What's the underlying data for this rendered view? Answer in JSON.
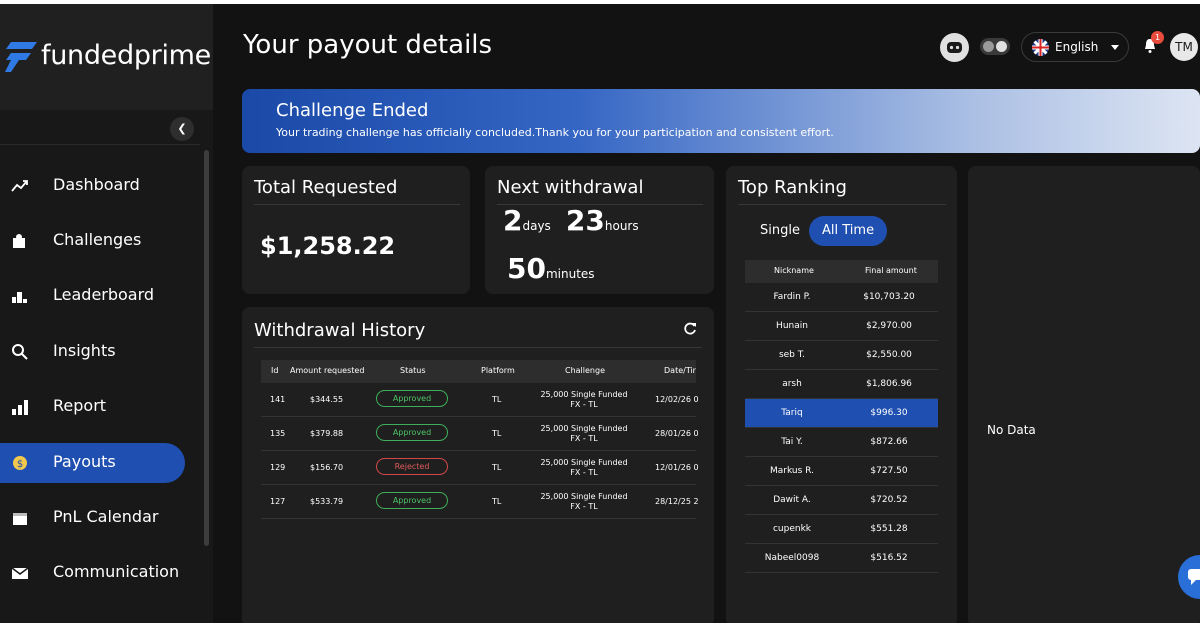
{
  "brand": {
    "name": "fundedprime"
  },
  "sidebar": {
    "items": [
      {
        "label": "Dashboard",
        "icon": "trend-icon"
      },
      {
        "label": "Challenges",
        "icon": "puzzle-icon"
      },
      {
        "label": "Leaderboard",
        "icon": "podium-icon"
      },
      {
        "label": "Insights",
        "icon": "search-icon"
      },
      {
        "label": "Report",
        "icon": "bar-chart-icon"
      },
      {
        "label": "Payouts",
        "icon": "dollar-icon",
        "active": true
      },
      {
        "label": "PnL Calendar",
        "icon": "calendar-icon"
      },
      {
        "label": "Communication",
        "icon": "mail-icon"
      }
    ]
  },
  "header": {
    "title": "Your payout details",
    "language": "English",
    "notification_count": "1",
    "avatar_initials": "TM"
  },
  "banner": {
    "title": "Challenge Ended",
    "subtitle": "Your trading challenge has officially concluded.Thank you for your participation and consistent effort."
  },
  "total_requested": {
    "title": "Total Requested",
    "amount": "$1,258.22"
  },
  "next_withdrawal": {
    "title": "Next withdrawal",
    "days": "2",
    "days_unit": "days",
    "hours": "23",
    "hours_unit": "hours",
    "minutes": "50",
    "minutes_unit": "minutes"
  },
  "withdrawal_history": {
    "title": "Withdrawal History",
    "columns": [
      "Id",
      "Amount requested",
      "Status",
      "Platform",
      "Challenge",
      "Date/Tir"
    ],
    "rows": [
      {
        "id": "141",
        "amount": "$344.55",
        "status": "Approved",
        "platform": "TL",
        "challenge_1": "25,000 Single Funded",
        "challenge_2": "FX - TL",
        "date": "12/02/26 0"
      },
      {
        "id": "135",
        "amount": "$379.88",
        "status": "Approved",
        "platform": "TL",
        "challenge_1": "25,000 Single Funded",
        "challenge_2": "FX - TL",
        "date": "28/01/26 0"
      },
      {
        "id": "129",
        "amount": "$156.70",
        "status": "Rejected",
        "platform": "TL",
        "challenge_1": "25,000 Single Funded",
        "challenge_2": "FX - TL",
        "date": "12/01/26 0"
      },
      {
        "id": "127",
        "amount": "$533.79",
        "status": "Approved",
        "platform": "TL",
        "challenge_1": "25,000 Single Funded",
        "challenge_2": "FX - TL",
        "date": "28/12/25 2"
      }
    ]
  },
  "top_ranking": {
    "title": "Top Ranking",
    "tabs": [
      "Single",
      "All Time"
    ],
    "active_tab": "All Time",
    "columns": [
      "Nickname",
      "Final amount"
    ],
    "rows": [
      {
        "nickname": "Fardin P.",
        "amount": "$10,703.20"
      },
      {
        "nickname": "Hunain",
        "amount": "$2,970.00"
      },
      {
        "nickname": "seb T.",
        "amount": "$2,550.00"
      },
      {
        "nickname": "arsh",
        "amount": "$1,806.96"
      },
      {
        "nickname": "Tariq",
        "amount": "$996.30",
        "highlight": true
      },
      {
        "nickname": "Tai Y.",
        "amount": "$872.66"
      },
      {
        "nickname": "Markus R.",
        "amount": "$727.50"
      },
      {
        "nickname": "Dawit A.",
        "amount": "$720.52"
      },
      {
        "nickname": "cupenkk",
        "amount": "$551.28"
      },
      {
        "nickname": "Nabeel0098",
        "amount": "$516.52"
      }
    ]
  },
  "right_panel": {
    "empty_text": "No Data"
  },
  "colors": {
    "accent": "#1f4fb0",
    "approved": "#4cc467",
    "rejected": "#e05a5a",
    "background": "#121212",
    "card": "#1f1f1f"
  }
}
